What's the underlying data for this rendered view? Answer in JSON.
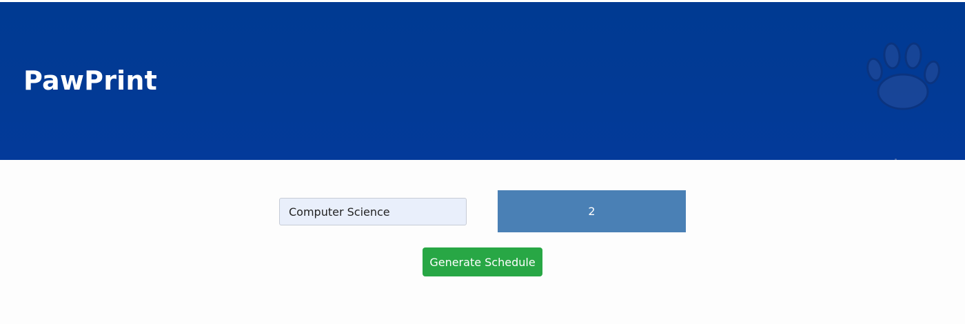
{
  "header": {
    "title": "PawPrint",
    "logo_icon": "paw-print-icon",
    "background_color": "#003a92"
  },
  "form": {
    "major_input": {
      "value": "Computer Science",
      "placeholder": ""
    },
    "semester_select": {
      "selected": "2",
      "background_color": "#4a80b5"
    },
    "generate_button": {
      "label": "Generate Schedule",
      "background_color": "#28a745"
    }
  }
}
